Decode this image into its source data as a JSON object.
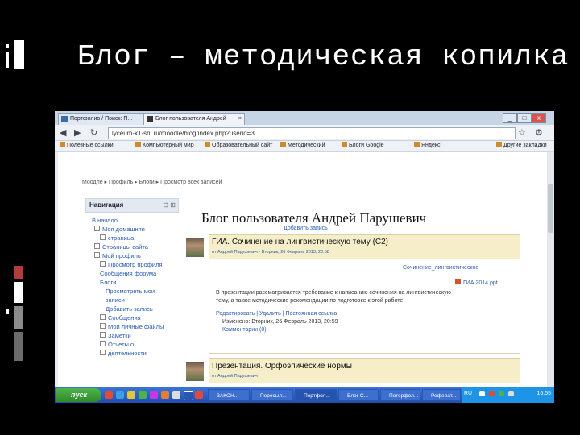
{
  "slide": {
    "title": "Блог – методическая копилка",
    "accent_colors": [
      "#ffffff",
      "#b23b3b",
      "#8b8b8b",
      "#6b6b6b"
    ]
  },
  "browser": {
    "tabs": [
      {
        "label": "Портфолио / Поиск: П..."
      },
      {
        "label": "Блог пользователя Андрей"
      }
    ],
    "window_buttons": [
      "_",
      "□",
      "x"
    ],
    "nav_buttons": [
      "back-arrow",
      "forward-arrow",
      "reload"
    ],
    "url": "lyceum-k1-shl.ru/moodle/blog/index.php?userid=3",
    "bookmarks": [
      "Полезные ссылки",
      "Компьютерный мир",
      "Образовательный сайт",
      "Методический",
      "Блоги Google",
      "Яндекс"
    ],
    "other_bookmarks": "Другие закладки"
  },
  "page": {
    "breadcrumb": "Моодле ▸ Профиль ▸ Блоги ▸ Просмотр всех записей",
    "nav": {
      "heading": "Навигация",
      "items": [
        {
          "label": "В начало",
          "indent": 0
        },
        {
          "label": "Моя домашняя",
          "indent": 1
        },
        {
          "label": "страница",
          "indent": 2
        },
        {
          "label": "Страницы сайта",
          "indent": 1
        },
        {
          "label": "Мой профиль",
          "indent": 1
        },
        {
          "label": "Просмотр профиля",
          "indent": 2
        },
        {
          "label": "Сообщения форума",
          "indent": 2
        },
        {
          "label": "Блоги",
          "indent": 2
        },
        {
          "label": "Просмотреть мои",
          "indent": 3
        },
        {
          "label": "записи",
          "indent": 3
        },
        {
          "label": "Добавить запись",
          "indent": 3
        },
        {
          "label": "Сообщения",
          "indent": 2
        },
        {
          "label": "Мои личные файлы",
          "indent": 2
        },
        {
          "label": "Заметки",
          "indent": 2
        },
        {
          "label": "Отчеты о",
          "indent": 2
        },
        {
          "label": "деятельности",
          "indent": 2
        }
      ]
    },
    "blog_title": "Блог пользователя Андрей Парушевич",
    "blog_subtitle": "Добавить запись",
    "posts": [
      {
        "title": "ГИА. Сочинение на лингвистическую тему (С2)",
        "meta": "от Андрей Парушевич - Вторник, 26 Февраль 2013, 20:58",
        "attach1": "Сочинение_лингвистическое",
        "attach2": "ГИА 2014.ppt",
        "body1": "В презентации рассматривается требование к написанию сочинения на лингвистическую",
        "body2": "тему, а также методические рекомендации по подготовке к этой работе",
        "actions": "Редактировать | Удалить | Постоянная ссылка",
        "edited": "Изменено: Вторник, 26 Февраль 2013, 20:59",
        "comments": "Комментарии (0)"
      },
      {
        "title": "Презентация. Орфоэпические нормы",
        "meta": "от Андрей Парушевич"
      }
    ]
  },
  "taskbar": {
    "start_label": "пуск",
    "items": [
      "ЗАКОН...",
      "Пересыл...",
      "Портфол...",
      "Блог С...",
      "Потерфол...",
      "Реферат..."
    ],
    "language": "RU",
    "clock": "16:55"
  }
}
